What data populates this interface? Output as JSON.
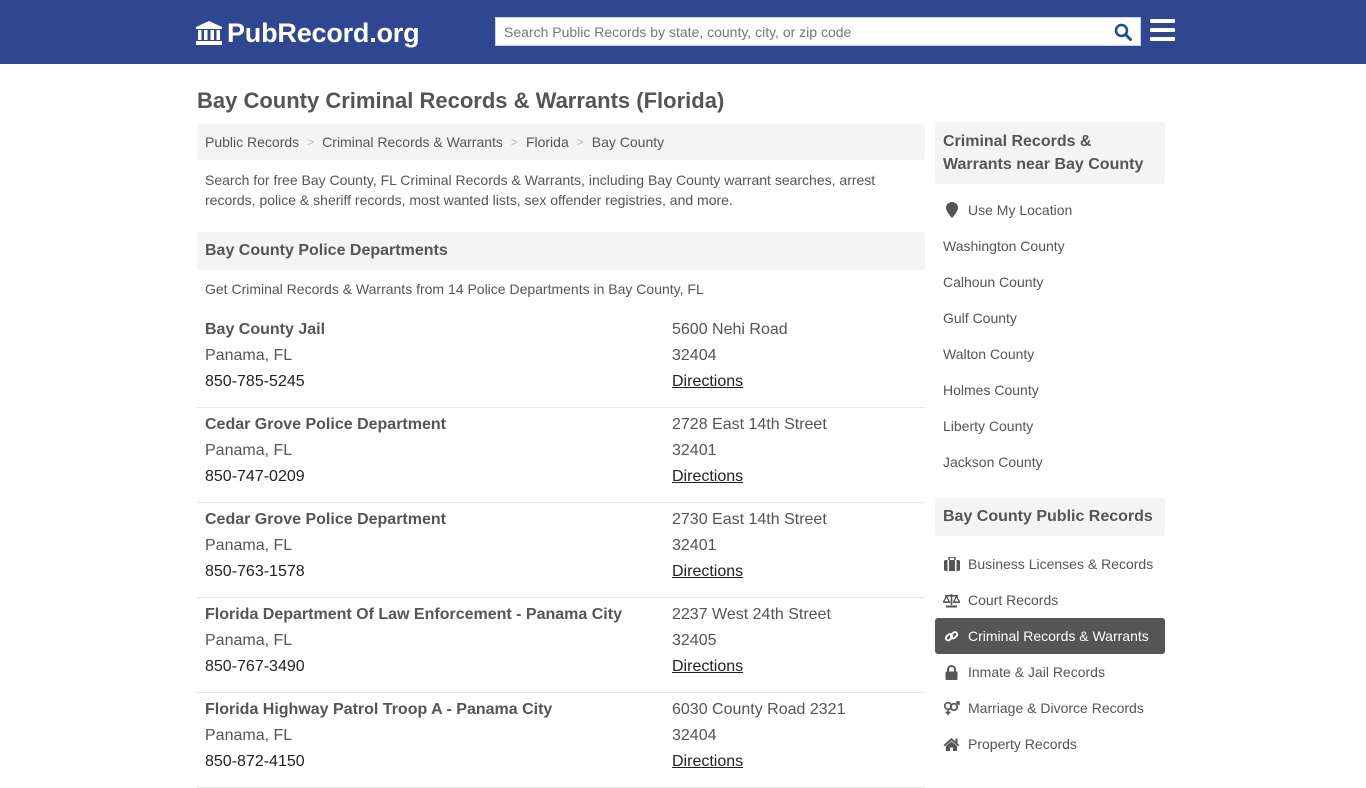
{
  "header": {
    "logo_text": "PubRecord.org",
    "search_placeholder": "Search Public Records by state, county, city, or zip code",
    "search_value": ""
  },
  "page": {
    "title": "Bay County Criminal Records & Warrants (Florida)",
    "breadcrumb": [
      "Public Records",
      "Criminal Records & Warrants",
      "Florida",
      "Bay County"
    ],
    "intro": "Search for free Bay County, FL Criminal Records & Warrants, including Bay County warrant searches, arrest records, police & sheriff records, most wanted lists, sex offender registries, and more."
  },
  "departments": {
    "heading": "Bay County Police Departments",
    "subtitle": "Get Criminal Records & Warrants from 14 Police Departments in Bay County, FL",
    "directions_label": "Directions",
    "items": [
      {
        "name": "Bay County Jail",
        "city": "Panama, FL",
        "phone": "850-785-5245",
        "address": "5600 Nehi Road",
        "zip": "32404"
      },
      {
        "name": "Cedar Grove Police Department",
        "city": "Panama, FL",
        "phone": "850-747-0209",
        "address": "2728 East 14th Street",
        "zip": "32401"
      },
      {
        "name": "Cedar Grove Police Department",
        "city": "Panama, FL",
        "phone": "850-763-1578",
        "address": "2730 East 14th Street",
        "zip": "32401"
      },
      {
        "name": "Florida Department Of Law Enforcement - Panama City",
        "city": "Panama, FL",
        "phone": "850-767-3490",
        "address": "2237 West 24th Street",
        "zip": "32405"
      },
      {
        "name": "Florida Highway Patrol Troop A - Panama City",
        "city": "Panama, FL",
        "phone": "850-872-4150",
        "address": "6030 County Road 2321",
        "zip": "32404"
      }
    ]
  },
  "sidebar": {
    "nearby_heading": "Criminal Records & Warrants near Bay County",
    "use_location": "Use My Location",
    "nearby": [
      "Washington County",
      "Calhoun County",
      "Gulf County",
      "Walton County",
      "Holmes County",
      "Liberty County",
      "Jackson County"
    ],
    "records_heading": "Bay County Public Records",
    "records": [
      {
        "label": "Business Licenses & Records",
        "icon": "briefcase-icon",
        "active": false
      },
      {
        "label": "Court Records",
        "icon": "scale-icon",
        "active": false
      },
      {
        "label": "Criminal Records & Warrants",
        "icon": "link-icon",
        "active": true
      },
      {
        "label": "Inmate & Jail Records",
        "icon": "lock-icon",
        "active": false
      },
      {
        "label": "Marriage & Divorce Records",
        "icon": "gender-icon",
        "active": false
      },
      {
        "label": "Property Records",
        "icon": "home-icon",
        "active": false
      }
    ]
  },
  "colors": {
    "header_bg": "#2e4790",
    "search_icon": "#1f4e8c",
    "active_item_bg": "#555555"
  }
}
